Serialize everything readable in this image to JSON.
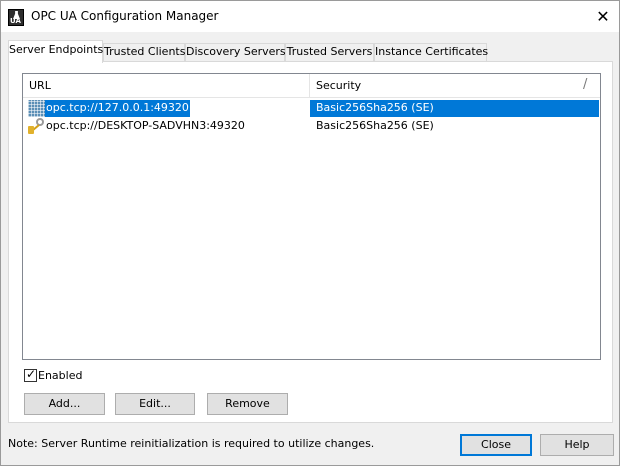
{
  "window": {
    "title": "OPC UA Configuration Manager",
    "app_icon_text": "UA",
    "close_glyph": "✕"
  },
  "tabs": [
    {
      "label": "Server Endpoints",
      "active": true
    },
    {
      "label": "Trusted Clients",
      "active": false
    },
    {
      "label": "Discovery Servers",
      "active": false
    },
    {
      "label": "Trusted Servers",
      "active": false
    },
    {
      "label": "Instance Certificates",
      "active": false
    }
  ],
  "endpoints": {
    "columns": [
      "URL",
      "Security"
    ],
    "sort_glyph": "/",
    "rows": [
      {
        "url": "opc.tcp://127.0.0.1:49320",
        "security": "Basic256Sha256 (SE)",
        "selected": true,
        "icon": "network-grid-icon"
      },
      {
        "url": "opc.tcp://DESKTOP-SADVHN3:49320",
        "security": "Basic256Sha256 (SE)",
        "selected": false,
        "icon": "key-icon"
      }
    ]
  },
  "enabled": {
    "label": "Enabled",
    "checked": true,
    "mark": "✓"
  },
  "actions": {
    "add": "Add...",
    "edit": "Edit...",
    "remove": "Remove"
  },
  "footer": {
    "note": "Note: Server Runtime reinitialization is required to utilize changes.",
    "close": "Close",
    "help": "Help"
  },
  "colors": {
    "selection": "#0078d7",
    "window_bg": "#f0f0f0",
    "button_bg": "#e1e1e1"
  }
}
